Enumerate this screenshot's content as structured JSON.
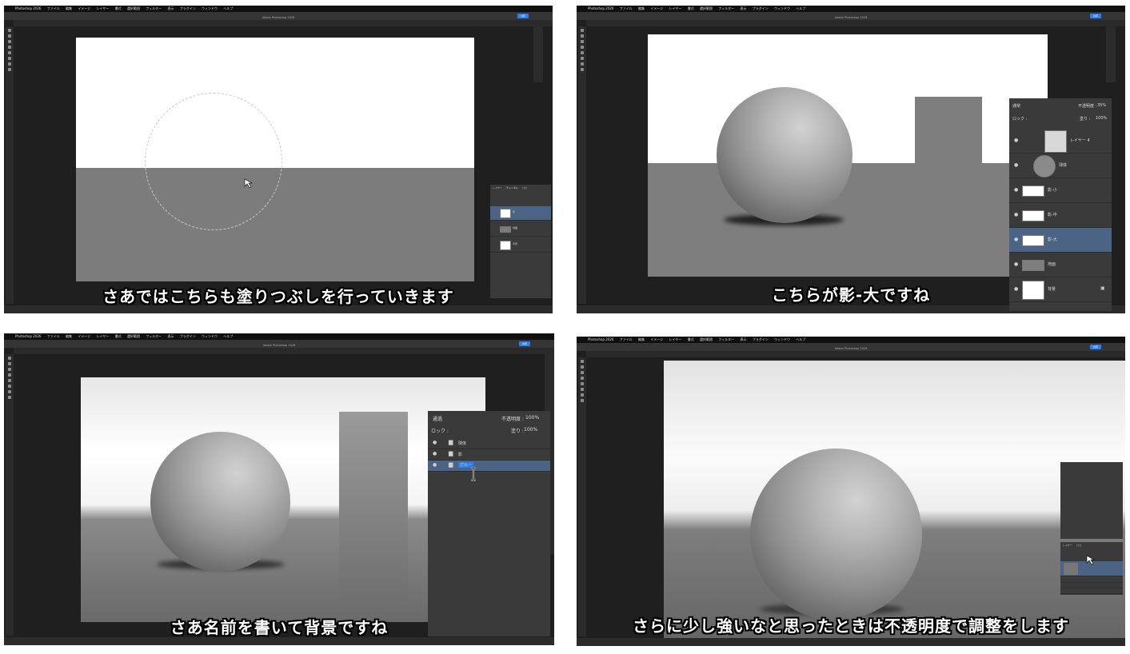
{
  "app": {
    "name": "Photoshop 2026",
    "title": "Adobe Photoshop 2026",
    "menu": [
      "ファイル",
      "編集",
      "イメージ",
      "レイヤー",
      "書式",
      "選択範囲",
      "フィルター",
      "表示",
      "プラグイン",
      "ウィンドウ",
      "ヘルプ"
    ],
    "share_label": "共有"
  },
  "panels": [
    {
      "caption": "さあではこちらも塗りつぶしを行っていきます",
      "layers_panel": {
        "tabs": [
          "レイヤー",
          "チャンネル",
          "パス"
        ],
        "layers": [
          "影",
          "地面",
          "背景"
        ]
      }
    },
    {
      "caption": "こちらが影-大ですね",
      "layers_panel": {
        "blend_mode": "通常",
        "opacity_label": "不透明度 :",
        "opacity": "35%",
        "lock_label": "ロック :",
        "fill_label": "塗り :",
        "fill": "100%",
        "layers": [
          "レイヤー 4",
          "球体",
          "影-小",
          "影-中",
          "影-大",
          "地面",
          "背景"
        ]
      }
    },
    {
      "caption": "さあ名前を書いて背景ですね",
      "layers_panel": {
        "blend_mode": "通過",
        "opacity_label": "不透明度 :",
        "opacity": "100%",
        "lock_label": "ロック :",
        "fill_label": "塗り :",
        "fill": "100%",
        "layers": [
          "球体",
          "影",
          "グルー"
        ]
      }
    },
    {
      "caption": "さらに少し強いなと思ったときは不透明度で調整をします",
      "layers_panel": {
        "tabs": [
          "レイヤー",
          "パス"
        ]
      }
    }
  ],
  "colors": {
    "ui_dark": "#1f1f1f",
    "panel": "#3a3a3a",
    "selection": "#4b6385",
    "share": "#2d7ff9"
  }
}
